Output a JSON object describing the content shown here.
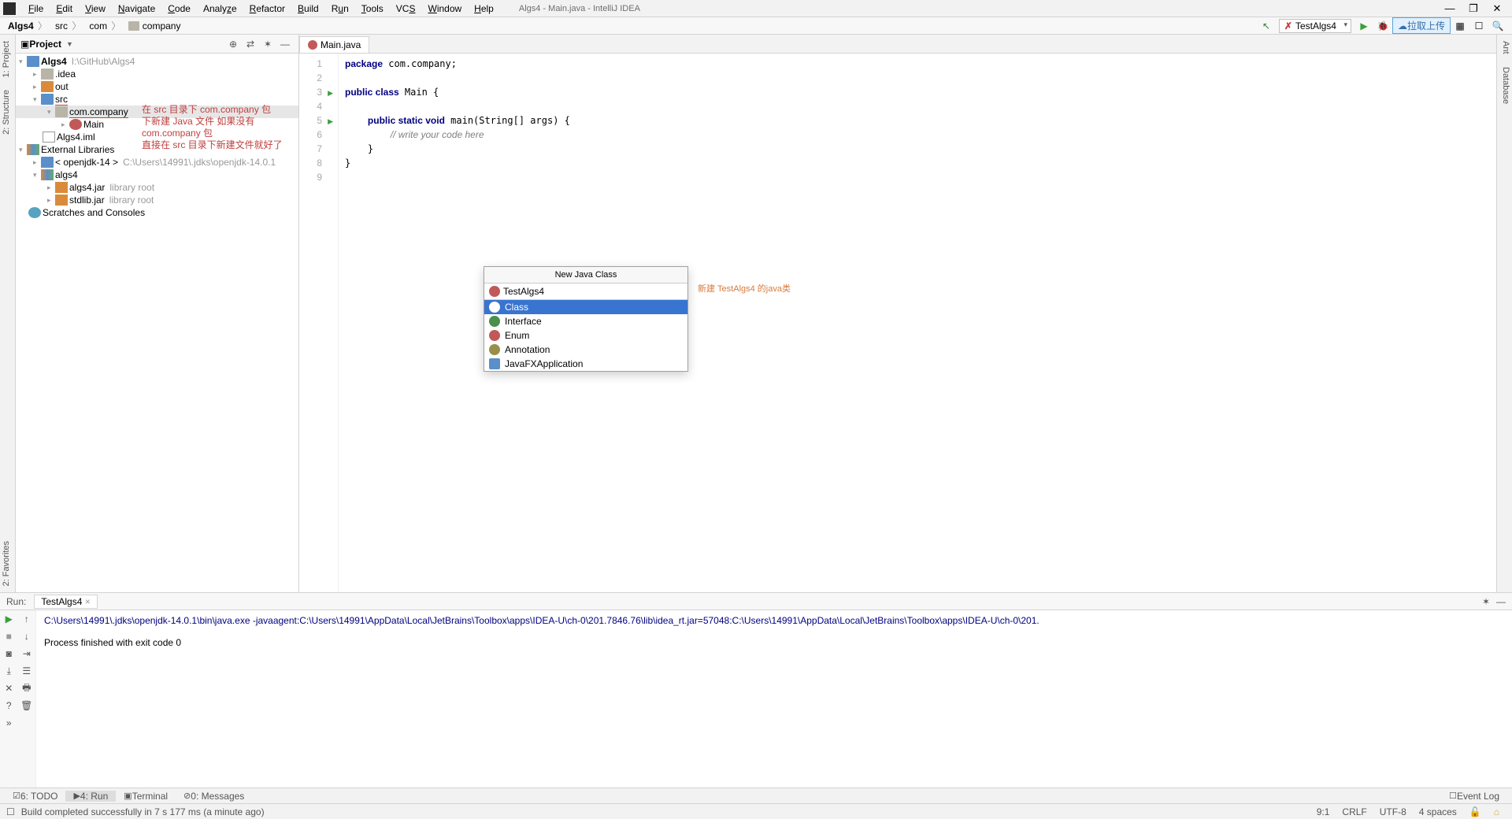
{
  "menubar": {
    "items": [
      "File",
      "Edit",
      "View",
      "Navigate",
      "Code",
      "Analyze",
      "Refactor",
      "Build",
      "Run",
      "Tools",
      "VCS",
      "Window",
      "Help"
    ],
    "title": "Algs4 - Main.java - IntelliJ IDEA",
    "win_min": "—",
    "win_max": "❐",
    "win_close": "✕"
  },
  "breadcrumb": {
    "items": [
      "Algs4",
      "src",
      "com",
      "company"
    ],
    "run_config": "TestAlgs4",
    "upload_label": "拉取上传"
  },
  "side_tabs_left": [
    "1: Project",
    "2: Structure"
  ],
  "side_tabs_right": [
    "Ant",
    "Database"
  ],
  "side_tabs_leftbottom": "2: Favorites",
  "project_panel": {
    "title": "Project",
    "tree": {
      "root": "Algs4",
      "root_hint": "I:\\GitHub\\Algs4",
      "idea": ".idea",
      "out": "out",
      "src": "src",
      "comcompany": "com.company",
      "main": "Main",
      "iml": "Algs4.iml",
      "extlib": "External Libraries",
      "jdk": "< openjdk-14 >",
      "jdk_hint": "C:\\Users\\14991\\.jdks\\openjdk-14.0.1",
      "algs4": "algs4",
      "algs4jar": "algs4.jar",
      "stdlibjar": "stdlib.jar",
      "libroot": "library root",
      "scratches": "Scratches and Consoles"
    },
    "annotation1": "在 src 目录下 com.company 包",
    "annotation2": "下新建 Java 文件 如果没有 com.company 包",
    "annotation3": "直接在 src 目录下新建文件就好了"
  },
  "editor": {
    "tab": "Main.java",
    "code": [
      {
        "n": 1,
        "t": "package com.company;"
      },
      {
        "n": 2,
        "t": ""
      },
      {
        "n": 3,
        "t": "public class Main {",
        "run": true
      },
      {
        "n": 4,
        "t": ""
      },
      {
        "n": 5,
        "t": "    public static void main(String[] args) {",
        "run": true
      },
      {
        "n": 6,
        "t": "        // write your code here"
      },
      {
        "n": 7,
        "t": "    }"
      },
      {
        "n": 8,
        "t": "}"
      },
      {
        "n": 9,
        "t": ""
      }
    ]
  },
  "dialog": {
    "title": "New Java Class",
    "input": "TestAlgs4",
    "options": [
      "Class",
      "Interface",
      "Enum",
      "Annotation",
      "JavaFXApplication"
    ],
    "annotation": "新建 TestAlgs4 的java类"
  },
  "run": {
    "title": "Run:",
    "tab": "TestAlgs4",
    "cmd": "C:\\Users\\14991\\.jdks\\openjdk-14.0.1\\bin\\java.exe -javaagent:C:\\Users\\14991\\AppData\\Local\\JetBrains\\Toolbox\\apps\\IDEA-U\\ch-0\\201.7846.76\\lib\\idea_rt.jar=57048:C:\\Users\\14991\\AppData\\Local\\JetBrains\\Toolbox\\apps\\IDEA-U\\ch-0\\201.",
    "result": "Process finished with exit code 0"
  },
  "bottom_tabs": {
    "todo": "6: TODO",
    "run": "4: Run",
    "terminal": "Terminal",
    "messages": "0: Messages",
    "event_log": "Event Log"
  },
  "statusbar": {
    "msg": "Build completed successfully in 7 s 177 ms (a minute ago)",
    "pos": "9:1",
    "crlf": "CRLF",
    "enc": "UTF-8",
    "indent": "4 spaces"
  }
}
